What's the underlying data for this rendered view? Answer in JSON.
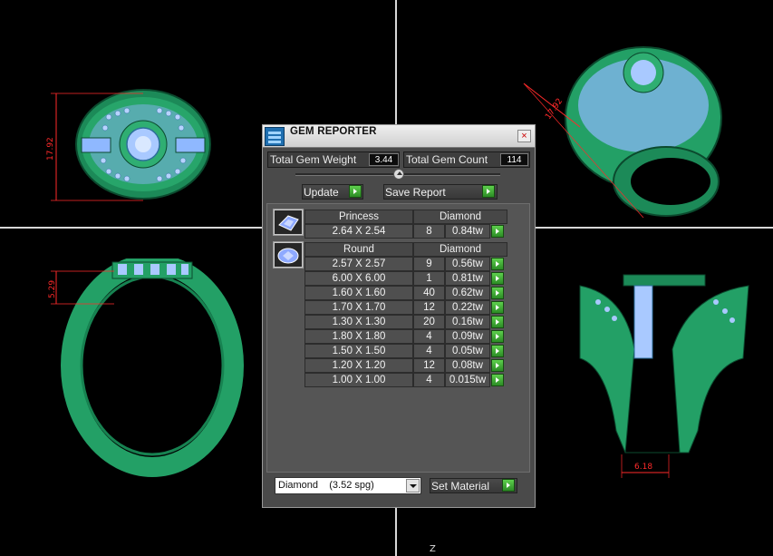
{
  "viewport": {
    "axis_label": "Z",
    "dimensions": {
      "top_left": "17.92",
      "bottom_left": "5.29",
      "top_right": "17.92",
      "bottom_right": "6.18"
    },
    "colors": {
      "background": "#000000",
      "ring_metal": "#23a066",
      "gems": "#9bc3ff",
      "dimension": "#ff2a2a"
    }
  },
  "panel": {
    "title": "GEM REPORTER",
    "icon": "gem-reporter-icon",
    "close_label": "×",
    "total_weight_label": "Total Gem Weight",
    "total_weight": "3.44",
    "total_count_label": "Total Gem Count",
    "total_count": "114",
    "update_label": "Update",
    "save_report_label": "Save Report",
    "groups": [
      {
        "cut": "Princess",
        "material": "Diamond",
        "icon": "princess-cut-gem-icon",
        "rows": [
          {
            "size": "2.64 X 2.54",
            "count": "8",
            "weight": "0.84tw"
          }
        ]
      },
      {
        "cut": "Round",
        "material": "Diamond",
        "icon": "round-cut-gem-icon",
        "rows": [
          {
            "size": "2.57 X 2.57",
            "count": "9",
            "weight": "0.56tw"
          },
          {
            "size": "6.00 X 6.00",
            "count": "1",
            "weight": "0.81tw"
          },
          {
            "size": "1.60 X 1.60",
            "count": "40",
            "weight": "0.62tw"
          },
          {
            "size": "1.70 X 1.70",
            "count": "12",
            "weight": "0.22tw"
          },
          {
            "size": "1.30 X 1.30",
            "count": "20",
            "weight": "0.16tw"
          },
          {
            "size": "1.80 X 1.80",
            "count": "4",
            "weight": "0.09tw"
          },
          {
            "size": "1.50 X 1.50",
            "count": "4",
            "weight": "0.05tw"
          },
          {
            "size": "1.20 X 1.20",
            "count": "12",
            "weight": "0.08tw"
          },
          {
            "size": "1.00 X 1.00",
            "count": "4",
            "weight": "0.015tw"
          }
        ]
      }
    ],
    "material_select": "Diamond    (3.52 spg)",
    "set_material_label": "Set Material"
  }
}
